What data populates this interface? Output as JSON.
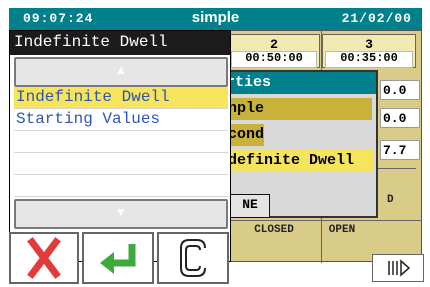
{
  "header": {
    "time": "09:07:24",
    "title": "simple",
    "date": "21/02/00"
  },
  "columns": [
    {
      "num": "2",
      "value": "00:50:00"
    },
    {
      "num": "3",
      "value": "00:35:00"
    }
  ],
  "cells": {
    "r1": "0.0",
    "r2": "0.0",
    "r3": "7.7"
  },
  "status": {
    "d": "D",
    "closed": "CLOSED",
    "open": "OPEN"
  },
  "properties": {
    "title": "rties",
    "rows": [
      "nple",
      "conds",
      "definite Dwell"
    ],
    "done_label": "NE"
  },
  "menu": {
    "title": "Indefinite Dwell",
    "up_glyph": "▲",
    "down_glyph": "▼",
    "items": [
      "Indefinite Dwell",
      "Starting Values"
    ]
  },
  "colors": {
    "teal": "#00808b",
    "highlight": "#f5e45c",
    "cancel": "#e23b3b",
    "enter": "#3cab3c"
  }
}
